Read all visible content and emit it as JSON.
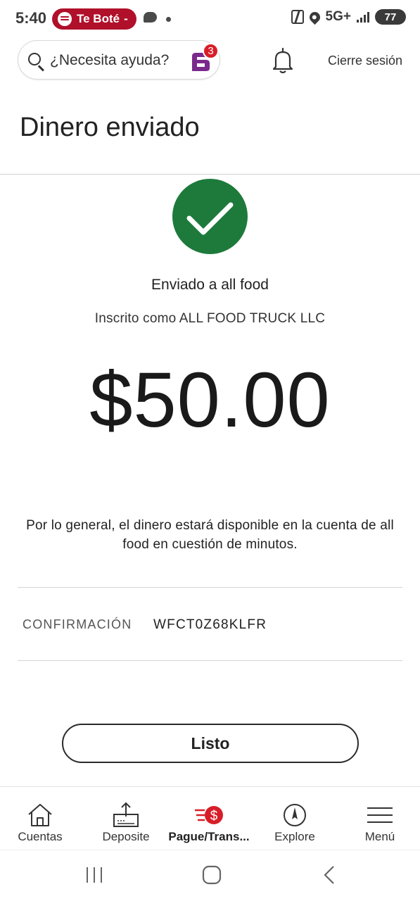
{
  "status_bar": {
    "time": "5:40",
    "media_label": "Te Boté",
    "media_dash": "-",
    "network": "5G+",
    "battery": "77"
  },
  "header": {
    "search_label": "¿Necesita ayuda?",
    "notification_count": "3",
    "logout_label": "Cierre sesión"
  },
  "page": {
    "title": "Dinero enviado",
    "sent_to": "Enviado a all food",
    "enrolled_as": "Inscrito como ALL FOOD TRUCK LLC",
    "amount": "$50.00",
    "note": "Por lo general, el dinero estará disponible en la cuenta de all food en cuestión de minutos.",
    "confirmation_label": "CONFIRMACIÓN",
    "confirmation_value": "WFCT0Z68KLFR",
    "done_label": "Listo"
  },
  "bottom_nav": {
    "items": [
      {
        "label": "Cuentas",
        "icon": "home-icon"
      },
      {
        "label": "Deposite",
        "icon": "deposit-icon"
      },
      {
        "label": "Pague/Trans...",
        "icon": "pay-transfer-icon",
        "active": true
      },
      {
        "label": "Explore",
        "icon": "compass-icon"
      },
      {
        "label": "Menú",
        "icon": "menu-icon"
      }
    ]
  },
  "colors": {
    "success_green": "#1d7a3b",
    "brand_red": "#d71e28",
    "fargo_purple": "#5b2a86"
  }
}
